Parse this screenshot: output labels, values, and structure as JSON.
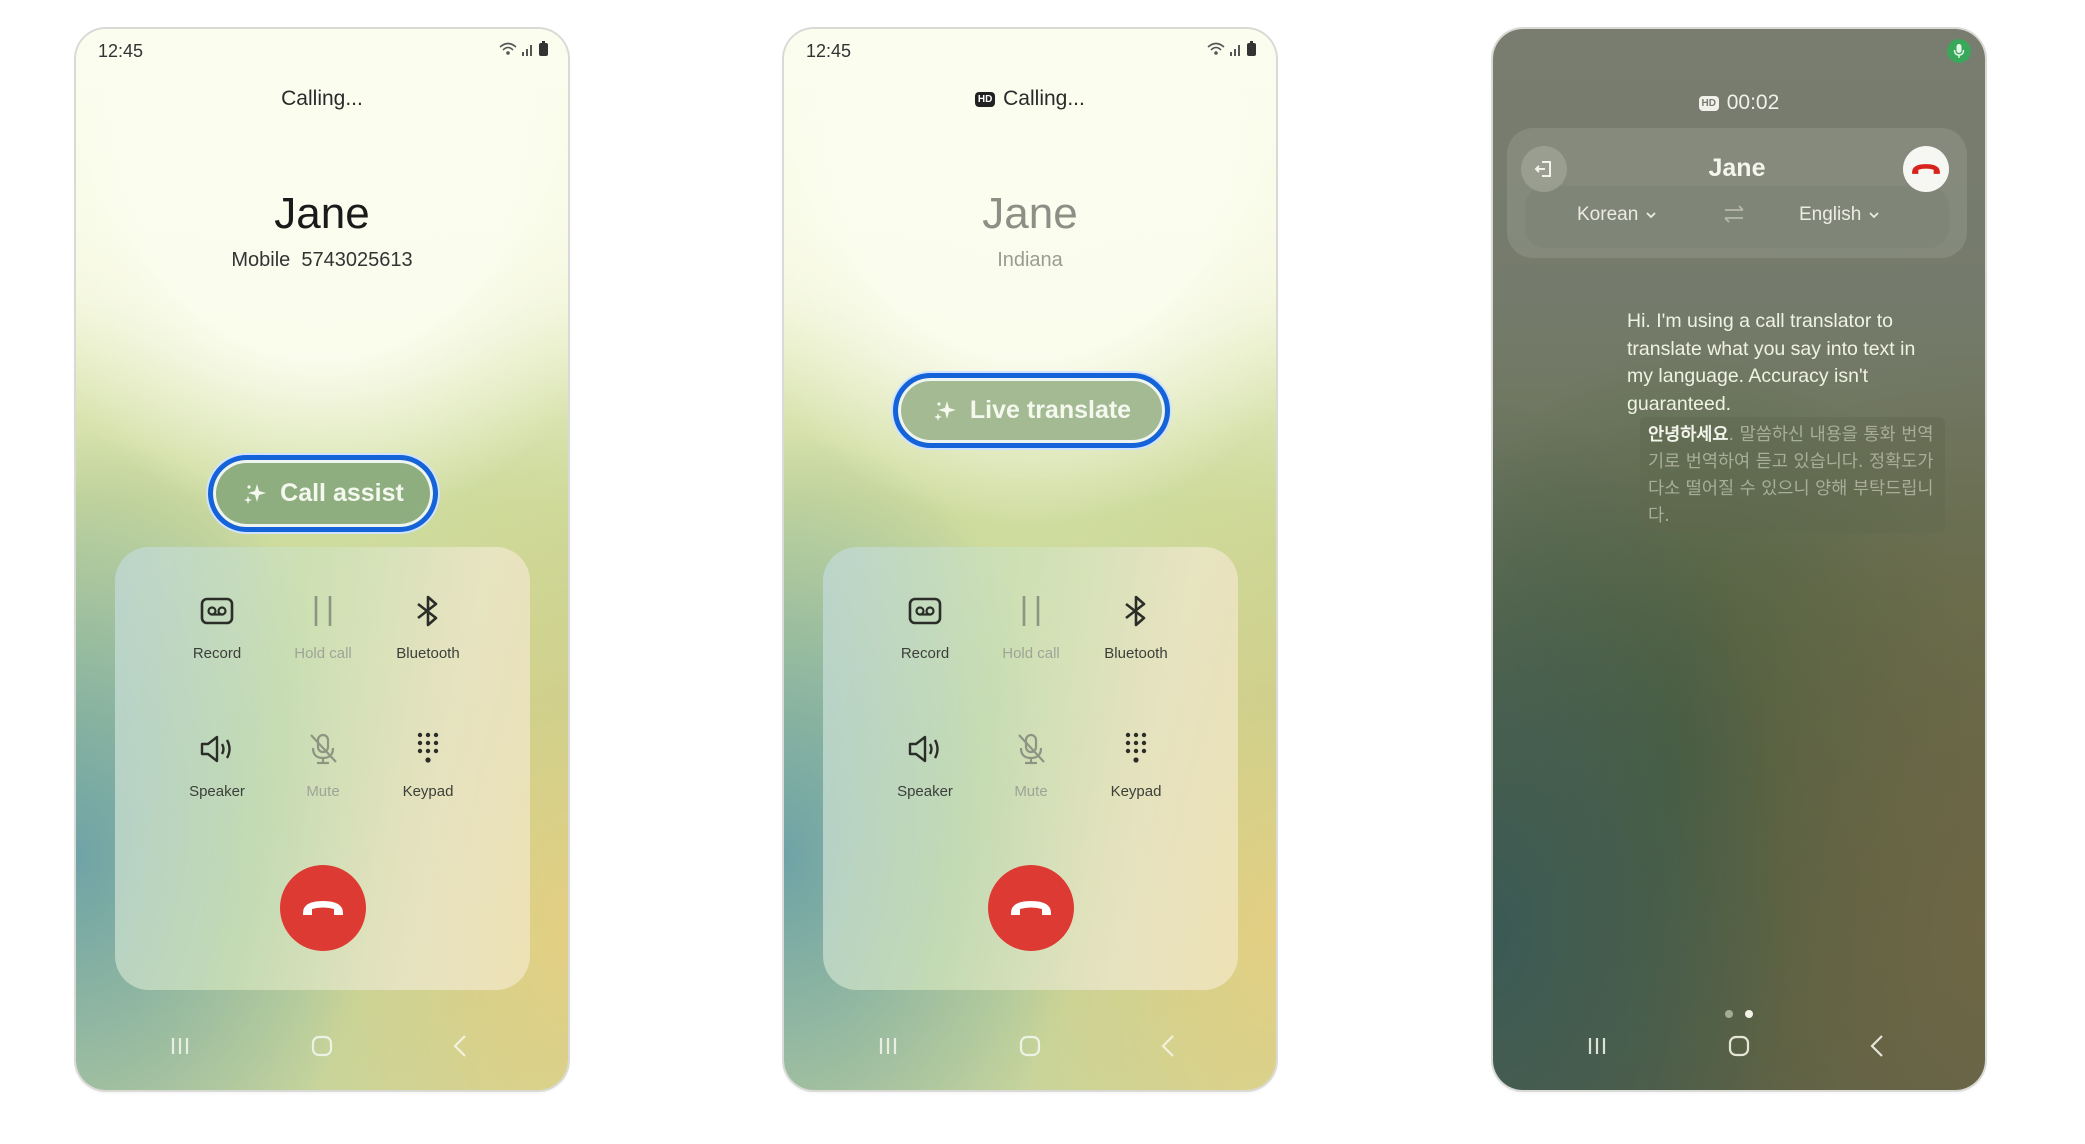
{
  "screens": [
    {
      "status_time": "12:45",
      "call_status": "Calling...",
      "hd_badge": "",
      "contact_name": "Jane",
      "contact_sub": "Mobile  5743025613",
      "assist_button": "Call assist",
      "controls": [
        {
          "label": "Record",
          "icon": "record-icon",
          "enabled": true
        },
        {
          "label": "Hold call",
          "icon": "pause-icon",
          "enabled": false
        },
        {
          "label": "Bluetooth",
          "icon": "bluetooth-icon",
          "enabled": true
        },
        {
          "label": "Speaker",
          "icon": "speaker-icon",
          "enabled": true
        },
        {
          "label": "Mute",
          "icon": "mic-off-icon",
          "enabled": false
        },
        {
          "label": "Keypad",
          "icon": "keypad-icon",
          "enabled": true
        }
      ],
      "end_call_icon": "end-call-icon"
    },
    {
      "status_time": "12:45",
      "call_status": "Calling...",
      "hd_badge": "HD",
      "contact_name": "Jane",
      "contact_sub": "Indiana",
      "assist_button": "Live translate",
      "controls": [
        {
          "label": "Record",
          "icon": "record-icon",
          "enabled": true
        },
        {
          "label": "Hold call",
          "icon": "pause-icon",
          "enabled": false
        },
        {
          "label": "Bluetooth",
          "icon": "bluetooth-icon",
          "enabled": true
        },
        {
          "label": "Speaker",
          "icon": "speaker-icon",
          "enabled": true
        },
        {
          "label": "Mute",
          "icon": "mic-off-icon",
          "enabled": false
        },
        {
          "label": "Keypad",
          "icon": "keypad-icon",
          "enabled": true
        }
      ],
      "end_call_icon": "end-call-icon"
    },
    {
      "hd_badge": "HD",
      "call_timer": "00:02",
      "contact_name": "Jane",
      "source_language": "Korean",
      "target_language": "English",
      "message_english": "Hi. I'm using a call translator to translate what you say into text in my language. Accuracy isn't guaranteed.",
      "message_korean_highlight": "안녕하세요",
      "message_korean_rest": ". 말씀하신 내용을 통화 번역기로 번역하여 듣고 있습니다. 정확도가 다소 떨어질 수 있으니 양해 부탁드립니다.",
      "page_indicator": {
        "total": 2,
        "current": 2
      }
    }
  ],
  "colors": {
    "end_call": "#dd3a33",
    "highlight_ring": "#1463d9",
    "assist_pill": "#8fae80",
    "mic_active": "#3aa85a"
  }
}
